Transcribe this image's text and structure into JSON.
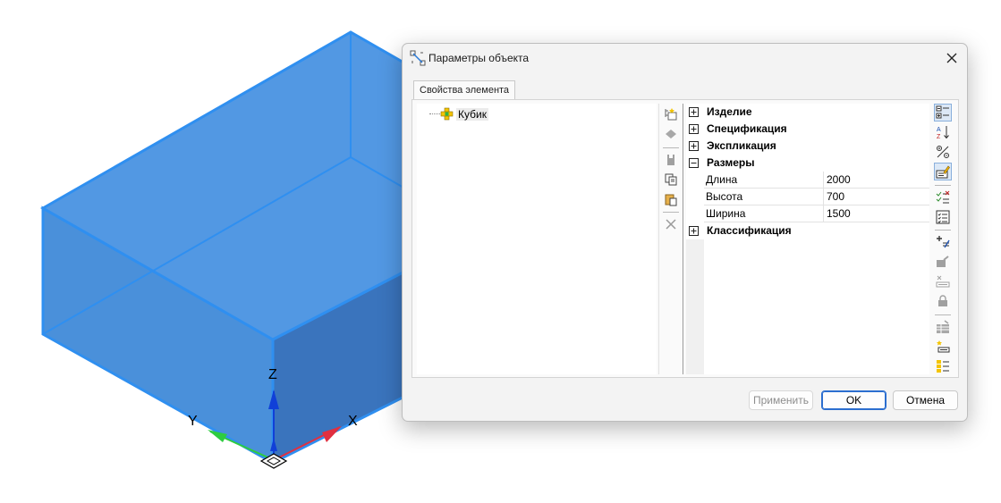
{
  "viewport": {
    "axes": {
      "z_label": "Z",
      "y_label": "Y",
      "x_label": "X"
    },
    "colors": {
      "box_fill": "#3f8fe0",
      "box_edge": "#2f8ff0",
      "z_axis": "#1040d8",
      "y_axis": "#2ecc40",
      "x_axis": "#e03040"
    }
  },
  "dialog": {
    "title": "Параметры объекта",
    "tab_label": "Свойства элемента",
    "tree": {
      "items": [
        {
          "label": "Кубик",
          "icon": "component-icon"
        }
      ]
    },
    "left_toolbar": [
      "new-object-icon",
      "shape-icon",
      "bucket-icon",
      "copy-icon",
      "paste-icon",
      "delete-icon"
    ],
    "property_grid": {
      "categories": [
        {
          "label": "Изделие",
          "expanded": false
        },
        {
          "label": "Спецификация",
          "expanded": false
        },
        {
          "label": "Экспликация",
          "expanded": false
        },
        {
          "label": "Размеры",
          "expanded": true,
          "rows": [
            {
              "name": "Длина",
              "value": "2000"
            },
            {
              "name": "Высота",
              "value": "700"
            },
            {
              "name": "Ширина",
              "value": "1500"
            }
          ]
        },
        {
          "label": "Классификация",
          "expanded": false
        }
      ]
    },
    "right_toolbar": [
      "categorized-icon",
      "sort-az-icon",
      "toggle-icon",
      "edit-property-icon",
      "checklist-icon",
      "list-icon",
      "add-property-icon",
      "link-icon",
      "remove-property-icon",
      "lock-icon",
      "table-icon",
      "new-row-icon",
      "group-icon"
    ],
    "buttons": {
      "apply": "Применить",
      "ok": "OK",
      "cancel": "Отмена"
    }
  }
}
